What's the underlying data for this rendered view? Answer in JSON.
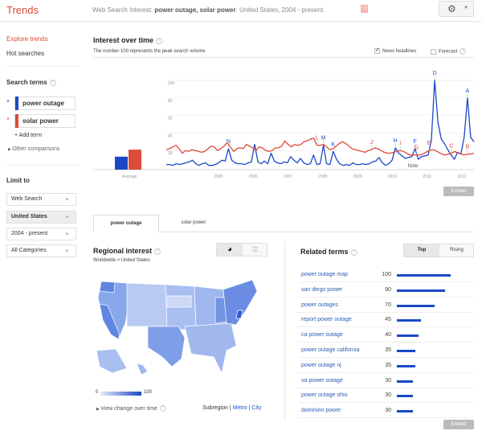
{
  "topbar": {
    "brand": "Trends",
    "query_prefix": "Web Search Interest:",
    "query_terms": "power outage, solar power",
    "query_suffix": ". United States, 2004 - present.",
    "share_icon": "google-plus-icon",
    "settings_icon": "gear-icon"
  },
  "sidebar": {
    "explore": "Explore trends",
    "hot": "Hot searches",
    "search_terms_heading": "Search terms",
    "terms": [
      {
        "label": "power outage",
        "color": "#1a49c6"
      },
      {
        "label": "solar power",
        "color": "#dd4b39"
      }
    ],
    "add_term": "+ Add term",
    "other_comparisons": "Other comparisons",
    "limit_heading": "Limit to",
    "limits": [
      {
        "label": "Web Search",
        "selected": false
      },
      {
        "label": "United States",
        "selected": true
      },
      {
        "label": "2004 - present",
        "selected": false
      },
      {
        "label": "All Categories",
        "selected": false
      }
    ]
  },
  "interest": {
    "title": "Interest over time",
    "subtitle": "The number 100 represents the peak search volume",
    "news_headlines": "News headlines",
    "news_checked": true,
    "forecast": "Forecast",
    "forecast_checked": false,
    "average_label": "Average",
    "note_label": "Note",
    "embed": "Embed"
  },
  "chart_data": {
    "type": "line",
    "title": "Interest over time",
    "ylim": [
      0,
      100
    ],
    "yticks": [
      20,
      40,
      60,
      80,
      100
    ],
    "xlabels": [
      "2005",
      "2006",
      "2007",
      "2008",
      "2009",
      "2010",
      "2011",
      "2012"
    ],
    "x_start": 2004.0,
    "x_end": 2012.85,
    "averages": [
      {
        "name": "power outage",
        "value": 13
      },
      {
        "name": "solar power",
        "value": 21
      }
    ],
    "series": [
      {
        "name": "power outage",
        "color": "#1a49c6",
        "values": [
          4,
          4,
          3,
          5,
          4,
          5,
          6,
          7,
          9,
          5,
          3,
          5,
          6,
          3,
          3,
          4,
          6,
          9,
          8,
          22,
          9,
          6,
          5,
          5,
          4,
          6,
          7,
          27,
          7,
          5,
          8,
          5,
          17,
          8,
          6,
          5,
          7,
          6,
          13,
          9,
          6,
          11,
          6,
          4,
          5,
          15,
          4,
          5,
          26,
          5,
          4,
          19,
          10,
          5,
          3,
          4,
          3,
          6,
          4,
          4,
          5,
          4,
          5,
          7,
          8,
          12,
          6,
          3,
          5,
          9,
          23,
          17,
          14,
          11,
          12,
          13,
          22,
          10,
          13,
          14,
          15,
          32,
          100,
          52,
          33,
          28,
          21,
          15,
          10,
          18,
          16,
          35,
          80,
          35,
          30
        ],
        "annotations": [
          {
            "letter": "N",
            "index": 19
          },
          {
            "letter": "M",
            "index": 48
          },
          {
            "letter": "K",
            "index": 51
          },
          {
            "letter": "H",
            "index": 70
          },
          {
            "letter": "F",
            "index": 76
          },
          {
            "letter": "D",
            "index": 82
          },
          {
            "letter": "A",
            "index": 92
          }
        ]
      },
      {
        "name": "solar power",
        "color": "#dd4b39",
        "values": [
          21,
          22,
          24,
          26,
          22,
          17,
          20,
          19,
          21,
          20,
          19,
          18,
          19,
          22,
          25,
          24,
          20,
          22,
          25,
          29,
          24,
          19,
          22,
          23,
          22,
          27,
          25,
          23,
          20,
          24,
          23,
          20,
          19,
          20,
          23,
          23,
          25,
          31,
          27,
          24,
          27,
          26,
          27,
          30,
          31,
          33,
          34,
          26,
          26,
          27,
          24,
          21,
          22,
          25,
          28,
          30,
          28,
          25,
          22,
          21,
          20,
          19,
          18,
          20,
          21,
          23,
          22,
          20,
          18,
          17,
          17,
          18,
          19,
          20,
          19,
          17,
          15,
          15,
          15,
          15,
          16,
          18,
          20,
          21,
          20,
          18,
          16,
          15,
          16,
          17,
          19,
          17,
          16,
          15,
          16,
          16,
          17
        ],
        "annotations": [
          {
            "letter": "L",
            "index": 47
          },
          {
            "letter": "J",
            "index": 64
          },
          {
            "letter": "I",
            "index": 73
          },
          {
            "letter": "G",
            "index": 78
          },
          {
            "letter": "E",
            "index": 82
          },
          {
            "letter": "C",
            "index": 89
          },
          {
            "letter": "B",
            "index": 94
          }
        ]
      }
    ]
  },
  "tabs": [
    {
      "label": "power outage",
      "active": true
    },
    {
      "label": "solar power",
      "active": false
    }
  ],
  "regional": {
    "title": "Regional interest",
    "breadcrumb": "Worldwide > United States",
    "view_map_icon": "globe-icon",
    "view_list_icon": "list-chart-icon",
    "legend_min": "0",
    "legend_max": "100",
    "view_change": "View change over time",
    "subregion": "Subregion",
    "metro": "Metro",
    "city": "City"
  },
  "related": {
    "title": "Related terms",
    "top": "Top",
    "rising": "Rising",
    "embed": "Embed",
    "items": [
      {
        "term": "power outage map",
        "value": 100
      },
      {
        "term": "san diego power",
        "value": 90
      },
      {
        "term": "power outages",
        "value": 70
      },
      {
        "term": "report power outage",
        "value": 45
      },
      {
        "term": "ca power outage",
        "value": 40
      },
      {
        "term": "power outage california",
        "value": 35
      },
      {
        "term": "power outage nj",
        "value": 35
      },
      {
        "term": "va power outage",
        "value": 30
      },
      {
        "term": "power outage ohio",
        "value": 30
      },
      {
        "term": "dominion power",
        "value": 30
      }
    ]
  }
}
